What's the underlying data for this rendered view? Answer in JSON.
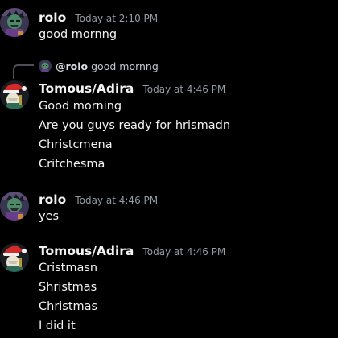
{
  "messages": [
    {
      "author": "rolo",
      "timestamp": "Today at 2:10 PM",
      "lines": [
        "good mornng"
      ]
    },
    {
      "author": "Tomous/Adira",
      "timestamp": "Today at 4:46 PM",
      "reply": {
        "mention": "@rolo",
        "text": "good mornng"
      },
      "lines": [
        "Good morning",
        "Are you guys ready for  hrismadn",
        "Christcmena",
        "Critchesma"
      ]
    },
    {
      "author": "rolo",
      "timestamp": "Today at 4:46 PM",
      "lines": [
        "yes"
      ]
    },
    {
      "author": "Tomous/Adira",
      "timestamp": "Today at 4:46 PM",
      "lines": [
        "Cristmasn",
        "Shristmas",
        "Christmas",
        "I did it"
      ]
    }
  ],
  "colors": {
    "background": "#000000",
    "username": "#f2f3f5",
    "timestamp": "#949ba4",
    "text": "#f2f3f5"
  },
  "icons": {
    "rolo_avatar": "rolo-avatar-icon",
    "tomous_avatar": "tomous-santa-avatar-icon"
  }
}
